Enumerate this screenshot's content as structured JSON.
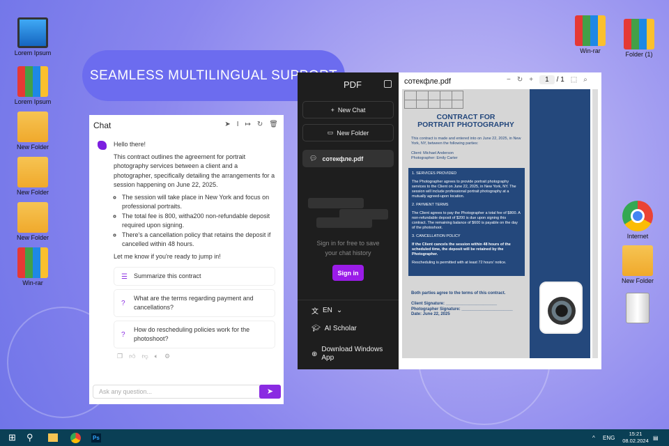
{
  "banner": "SEAMLESS MULTILINGUAL SUPPORT",
  "desktop_left": [
    "Lorem Ipsum",
    "Lorem Ipsum",
    "New Folder",
    "New Folder",
    "New Folder",
    "Win-rar"
  ],
  "desktop_right": [
    "Win-rar",
    "Folder (1)",
    "Internet",
    "New Folder"
  ],
  "chat": {
    "title": "Chat",
    "greeting": "Hello there!",
    "intro": "This contract outlines the agreement for portrait photography services between a client and a photographer, specifically detailing the arrangements for a session happening on June 22, 2025.",
    "bullets": [
      "The session will take place in New York and focus on professional portraits.",
      "The total fee is 800, witha200 non-refundable deposit required upon signing.",
      "There's a cancellation policy that retains the deposit if cancelled within 48 hours."
    ],
    "closing": "Let me know if you're ready to jump in!",
    "suggestions": [
      "Summarize this contract",
      "What are the terms regarding payment and cancellations?",
      "How do rescheduling policies work for the photoshoot?"
    ],
    "placeholder": "Ask any question..."
  },
  "sidebar": {
    "logo": "PDF",
    "new_chat": "New Chat",
    "new_folder": "New Folder",
    "file": "сотекфле.pdf",
    "sign_msg": "Sign in for free to save your chat history",
    "sign_in": "Sign in",
    "lang": "EN",
    "scholar": "AI Scholar",
    "download": "Download Windows App"
  },
  "viewer": {
    "filename": "сотекфле.pdf",
    "page": "1",
    "total": "/ 1"
  },
  "doc": {
    "title1": "CONTRACT FOR",
    "title2": "PORTRAIT PHOTOGRAPHY",
    "intro": "This contract is made and entered into on June 22, 2025, in New York, NY, between the following parties:",
    "client": "Client: Michael Anderson",
    "photographer": "Photographer: Emily Carter",
    "s1": "1. SERVICES PROVIDED",
    "s1t": "The Photographer agrees to provide portrait photography services to the Client on June 22, 2025, in New York, NY. The session will include professional portrait photography at a mutually agreed-upon location.",
    "s2": "2. PAYMENT TERMS",
    "s2t": "The Client agrees to pay the Photographer a total fee of $800. A non-refundable deposit of $200 is due upon signing this contract. The remaining balance of $600 is payable on the day of the photoshoot.",
    "s3": "3. CANCELLATION POLICY",
    "s3t": "If the Client cancels the session within 48 hours of the scheduled time, the deposit will be retained by the Photographer.",
    "s3b": "Rescheduling is permitted with at least 72 hours' notice.",
    "agree": "Both parties agree to the terms of this contract.",
    "sig1": "Client Signature: ______________________",
    "sig2": "Photographer Signature: ______________________",
    "date": "Date: June 22, 2025"
  },
  "taskbar": {
    "lang": "ENG",
    "time": "15:21",
    "date": "08.02.2024",
    "ps": "Ps"
  }
}
